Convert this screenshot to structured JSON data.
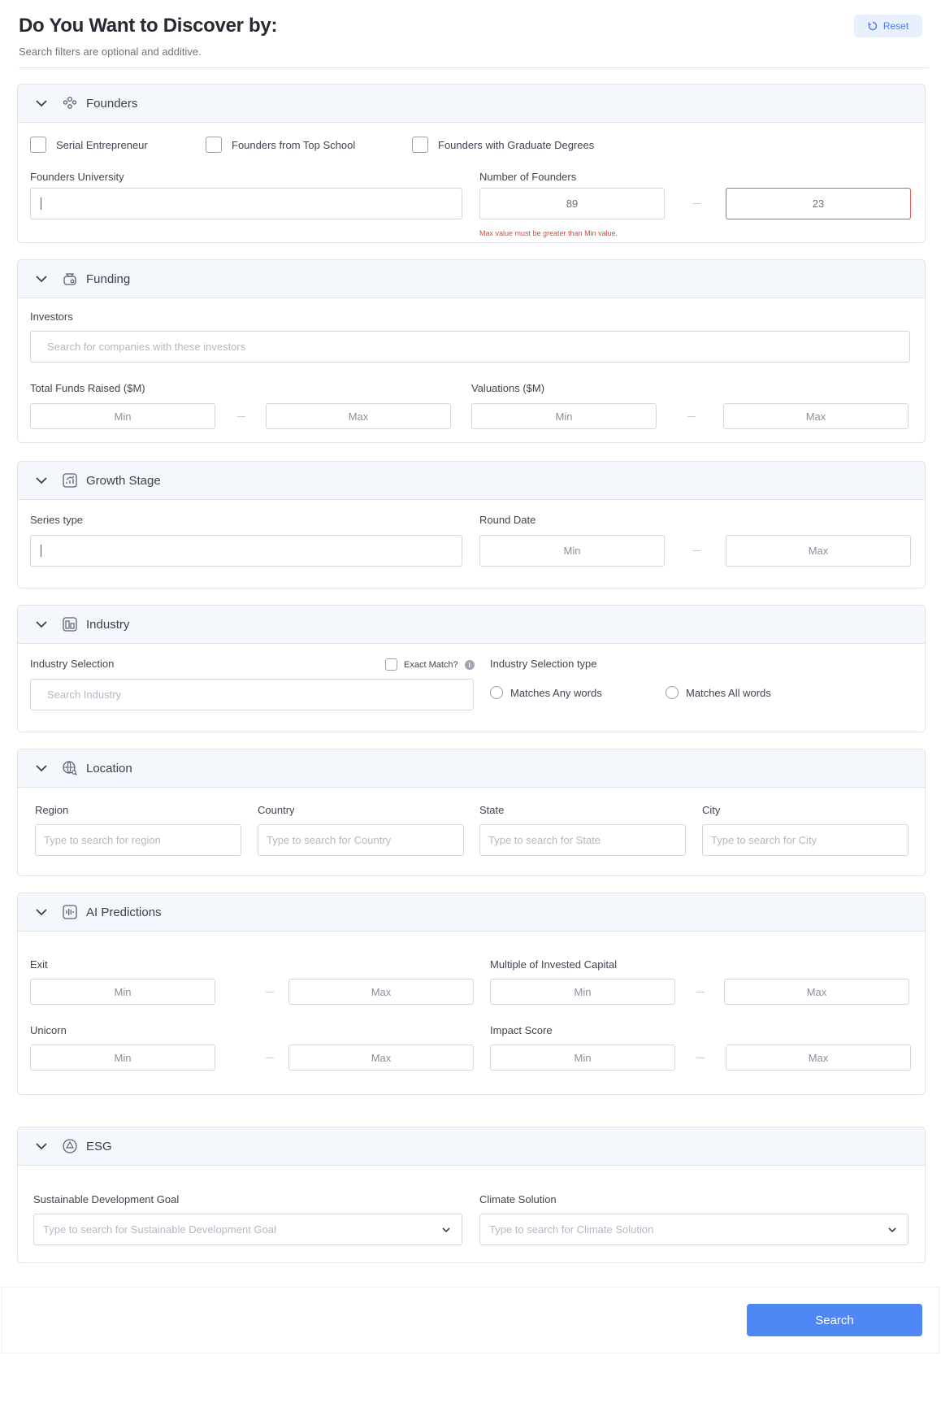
{
  "header": {
    "title": "Do You Want to Discover by:",
    "subtitle": "Search filters are optional and additive.",
    "reset_label": "Reset"
  },
  "founders": {
    "title": "Founders",
    "checkboxes": [
      "Serial Entrepreneur",
      "Founders from Top School",
      "Founders with Graduate Degrees"
    ],
    "university_label": "Founders University",
    "count_label": "Number of Founders",
    "count_min": "89",
    "count_max": "23",
    "error": "Max value must be greater than Min value."
  },
  "funding": {
    "title": "Funding",
    "investors_label": "Investors",
    "investors_placeholder": "Search for companies with these investors",
    "funds_label": "Total Funds Raised ($M)",
    "valuations_label": "Valuations ($M)",
    "min": "Min",
    "max": "Max"
  },
  "growth": {
    "title": "Growth Stage",
    "series_label": "Series type",
    "round_label": "Round Date",
    "min": "Min",
    "max": "Max"
  },
  "industry": {
    "title": "Industry",
    "selection_label": "Industry Selection",
    "exact_label": "Exact Match?",
    "info_glyph": "i",
    "search_placeholder": "Search Industry",
    "type_label": "Industry Selection type",
    "options": [
      "Matches Any words",
      "Matches All words"
    ]
  },
  "location": {
    "title": "Location",
    "fields": [
      {
        "label": "Region",
        "placeholder": "Type to search for region"
      },
      {
        "label": "Country",
        "placeholder": "Type to search for Country"
      },
      {
        "label": "State",
        "placeholder": "Type to search for State"
      },
      {
        "label": "City",
        "placeholder": "Type to search for City"
      }
    ]
  },
  "ai": {
    "title": "AI Predictions",
    "exit_label": "Exit",
    "moic_label": "Multiple of Invested Capital",
    "unicorn_label": "Unicorn",
    "impact_label": "Impact Score",
    "min": "Min",
    "max": "Max"
  },
  "esg": {
    "title": "ESG",
    "sdg_label": "Sustainable Development Goal",
    "sdg_placeholder": "Type to search for Sustainable Development Goal",
    "climate_label": "Climate Solution",
    "climate_placeholder": "Type to search for Climate Solution"
  },
  "footer": {
    "search_label": "Search"
  },
  "colors": {
    "accent": "#4f88f5",
    "error": "#d9483b",
    "panel_header": "#f4f7fc"
  }
}
